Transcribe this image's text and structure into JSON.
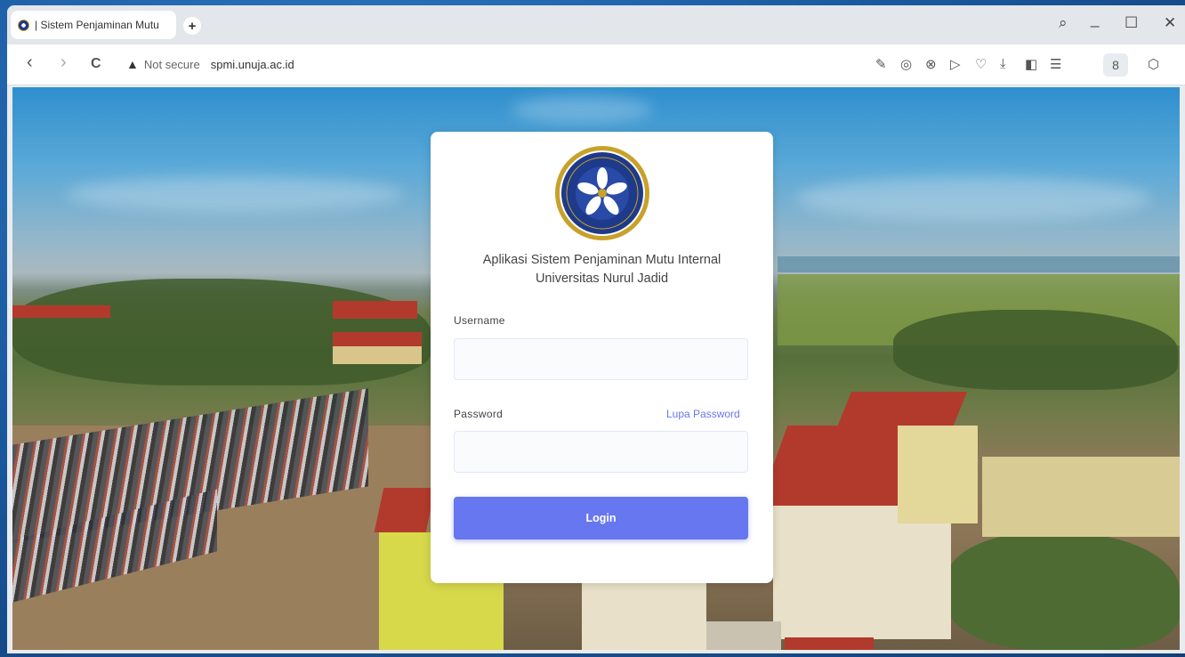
{
  "browser": {
    "tab_title": "| Sistem Penjaminan Mutu",
    "new_tab_symbol": "+",
    "window_controls": {
      "search": "⌕",
      "minimize": "_",
      "maximize": "☐",
      "close": "✕"
    },
    "nav": {
      "back": "‹",
      "forward": "›",
      "reload": "C"
    },
    "security_label": "Not secure",
    "url": "spmi.unuja.ac.id",
    "toolbar_icons": [
      "edit-icon",
      "camera-icon",
      "shield-icon",
      "send-icon",
      "heart-icon",
      "download-icon",
      "sidebar-icon",
      "menu-icon",
      "profile-icon",
      "extension-icon"
    ],
    "toolbar_glyphs": [
      "✎",
      "◎",
      "⊗",
      "▷",
      "♡",
      "⤓",
      "◧",
      "☰",
      "8",
      "⬡"
    ]
  },
  "login": {
    "app_title_line1": "Aplikasi Sistem Penjaminan Mutu Internal",
    "app_title_line2": "Universitas Nurul Jadid",
    "username_label": "Username",
    "username_value": "",
    "password_label": "Password",
    "password_value": "",
    "forgot_password": "Lupa Password",
    "login_button": "Login"
  },
  "logo": {
    "top_text": "UNIVERSITAS NURUL JADID",
    "bottom_text": "PAITON PROBOLINGGO"
  },
  "colors": {
    "accent": "#6777ef",
    "logo_blue": "#1e3a8a",
    "logo_gold": "#c8a12a"
  }
}
